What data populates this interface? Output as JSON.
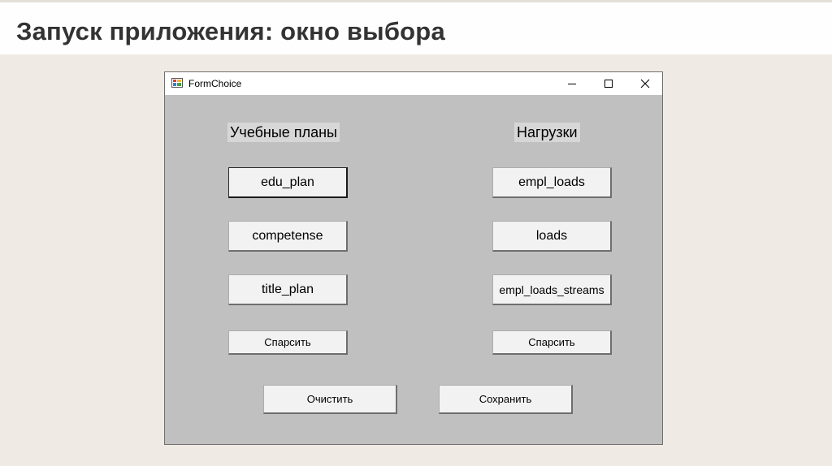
{
  "slide": {
    "title": "Запуск приложения: окно выбора"
  },
  "window": {
    "title": "FormChoice",
    "controls": {
      "minimize": "—",
      "maximize": "☐",
      "close": "✕"
    }
  },
  "left_group": {
    "label": "Учебные планы",
    "buttons": [
      "edu_plan",
      "competense",
      "title_plan"
    ],
    "parse_button": "Спарсить"
  },
  "right_group": {
    "label": "Нагрузки",
    "buttons": [
      "empl_loads",
      "loads",
      "empl_loads_streams"
    ],
    "parse_button": "Спарсить"
  },
  "bottom": {
    "clear_button": "Очистить",
    "save_button": "Сохранить"
  }
}
